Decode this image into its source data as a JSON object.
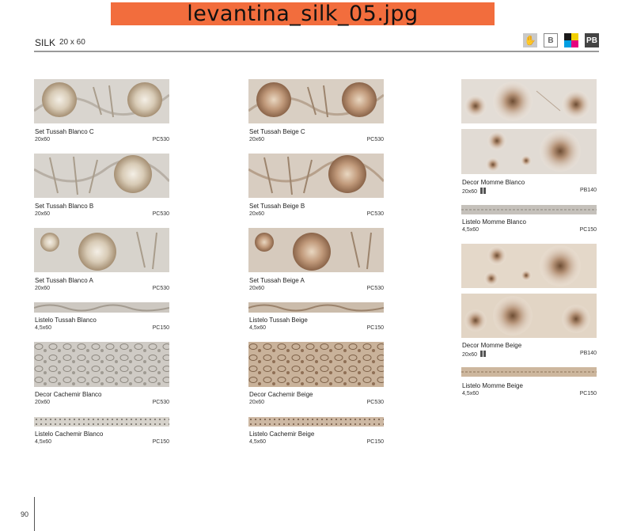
{
  "banner": {
    "filename": "levantina_silk_05.jpg"
  },
  "header": {
    "title": "SILK",
    "size": "20 x 60",
    "icons": [
      {
        "name": "hand-icon",
        "glyph": "✋"
      },
      {
        "name": "b-icon",
        "glyph": "B"
      },
      {
        "name": "color-icon",
        "glyph": ""
      },
      {
        "name": "pb-icon",
        "glyph": "PB"
      }
    ],
    "colors": {
      "accent": "#f26d3d",
      "rule": "#9a9a9a",
      "icon_dark": "#444444"
    }
  },
  "columns": [
    {
      "items": [
        {
          "name": "Set Tussah Blanco C",
          "dim": "20x60",
          "code": "PC530"
        },
        {
          "name": "Set Tussah Blanco B",
          "dim": "20x60",
          "code": "PC530"
        },
        {
          "name": "Set Tussah Blanco A",
          "dim": "20x60",
          "code": "PC530"
        },
        {
          "name": "Listelo Tussah Blanco",
          "dim": "4,5x60",
          "code": "PC150"
        },
        {
          "name": "Decor Cachemir Blanco",
          "dim": "20x60",
          "code": "PC530"
        },
        {
          "name": "Listelo Cachemir Blanco",
          "dim": "4,5x60",
          "code": "PC150"
        }
      ]
    },
    {
      "items": [
        {
          "name": "Set Tussah Beige C",
          "dim": "20x60",
          "code": "PC530"
        },
        {
          "name": "Set Tussah Beige B",
          "dim": "20x60",
          "code": "PC530"
        },
        {
          "name": "Set Tussah Beige A",
          "dim": "20x60",
          "code": "PC530"
        },
        {
          "name": "Listelo Tussah Beige",
          "dim": "4,5x60",
          "code": "PC150"
        },
        {
          "name": "Decor Cachemir Beige",
          "dim": "20x60",
          "code": "PC530"
        },
        {
          "name": "Listelo Cachemir Beige",
          "dim": "4,5x60",
          "code": "PC150"
        }
      ]
    },
    {
      "items": [
        {
          "name": "Decor Momme Blanco",
          "dim": "20x60",
          "code": "PB140"
        },
        {
          "name": "Listelo Momme Blanco",
          "dim": "4,5x60",
          "code": "PC150"
        },
        {
          "name": "Decor Momme Beige",
          "dim": "20x60",
          "code": "PB140"
        },
        {
          "name": "Listelo Momme Beige",
          "dim": "4,5x60",
          "code": "PC150"
        }
      ]
    }
  ],
  "footer": {
    "page_number": "90"
  }
}
